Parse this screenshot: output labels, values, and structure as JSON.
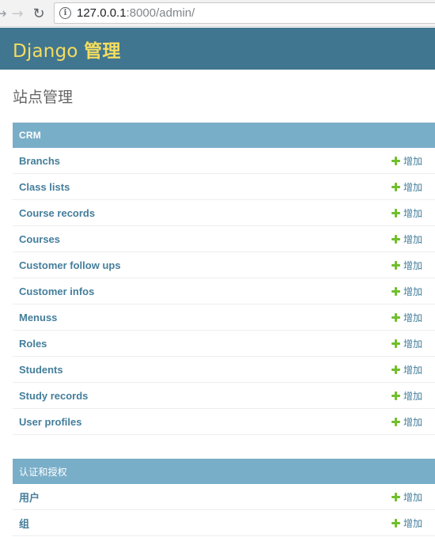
{
  "browser": {
    "url_host": "127.0.0.1",
    "url_rest": ":8000/admin/",
    "back_icon": "back-arrow-icon",
    "forward_icon": "forward-arrow-icon",
    "reload_icon": "reload-icon",
    "info_icon": "info-icon"
  },
  "header": {
    "brand_latin": "Django",
    "brand_cjk": "管理",
    "background": "#417690",
    "brand_color": "#f5dd5d"
  },
  "page": {
    "title": "站点管理"
  },
  "modules": [
    {
      "caption": "CRM",
      "models": [
        {
          "name": "Branchs",
          "add_label": "增加"
        },
        {
          "name": "Class lists",
          "add_label": "增加"
        },
        {
          "name": "Course records",
          "add_label": "增加"
        },
        {
          "name": "Courses",
          "add_label": "增加"
        },
        {
          "name": "Customer follow ups",
          "add_label": "增加"
        },
        {
          "name": "Customer infos",
          "add_label": "增加"
        },
        {
          "name": "Menuss",
          "add_label": "增加"
        },
        {
          "name": "Roles",
          "add_label": "增加"
        },
        {
          "name": "Students",
          "add_label": "增加"
        },
        {
          "name": "Study records",
          "add_label": "增加"
        },
        {
          "name": "User profiles",
          "add_label": "增加"
        }
      ]
    },
    {
      "caption": "认证和授权",
      "models": [
        {
          "name": "用户",
          "add_label": "增加"
        },
        {
          "name": "组",
          "add_label": "增加"
        }
      ]
    }
  ],
  "colors": {
    "caption_bg": "#79aec8",
    "link": "#447e9b",
    "add_icon": "#70bf2b"
  }
}
